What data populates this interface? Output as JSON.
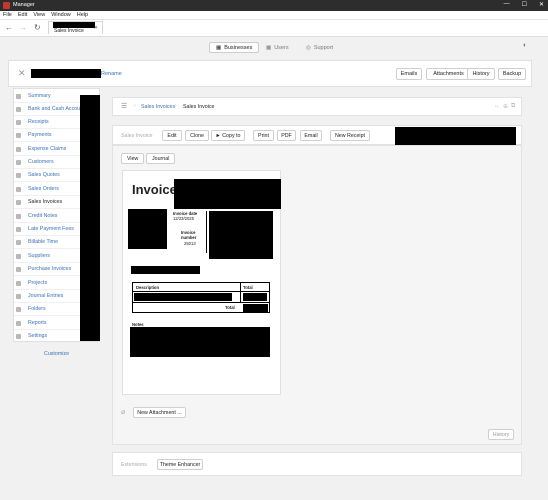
{
  "window": {
    "app_title": "Manager",
    "controls": [
      "—",
      "☐",
      "✕"
    ]
  },
  "menu": [
    "File",
    "Edit",
    "View",
    "Window",
    "Help"
  ],
  "tab": {
    "title": "Sales Invoice",
    "close": "✕"
  },
  "modes": [
    {
      "label": "Businesses",
      "icon": "businesses-icon",
      "active": true
    },
    {
      "label": "Users",
      "icon": "users-icon",
      "active": false
    },
    {
      "label": "Support",
      "icon": "support-icon",
      "active": false
    }
  ],
  "header": {
    "rename": "Rename",
    "buttons": [
      "Emails",
      "Attachments",
      "History",
      "Backup"
    ]
  },
  "sidebar": {
    "items": [
      {
        "label": "Summary"
      },
      {
        "label": "Bank and Cash Accounts"
      },
      {
        "label": "Receipts"
      },
      {
        "label": "Payments"
      },
      {
        "label": "Expense Claims"
      },
      {
        "label": "Customers"
      },
      {
        "label": "Sales Quotes"
      },
      {
        "label": "Sales Orders"
      },
      {
        "label": "Sales Invoices",
        "active": true
      },
      {
        "label": "Credit Notes"
      },
      {
        "label": "Late Payment Fees"
      },
      {
        "label": "Billable Time"
      },
      {
        "label": "Suppliers"
      },
      {
        "label": "Purchase Invoices"
      },
      {
        "label": "Projects"
      },
      {
        "label": "Journal Entries"
      },
      {
        "label": "Folders"
      },
      {
        "label": "Reports"
      },
      {
        "label": "Settings"
      }
    ],
    "customize": "Customize"
  },
  "breadcrumb": {
    "first": "Sales Invoices",
    "sep": "›",
    "second": "Sales Invoice"
  },
  "toolbar": {
    "label": "Sales Invoice",
    "edit": "Edit",
    "clone": "Clone",
    "copy_to": "► Copy to",
    "print": "Print",
    "pdf": "PDF",
    "email": "Email",
    "new_receipt": "New Receipt"
  },
  "view_tabs": {
    "view": "View",
    "journal": "Journal"
  },
  "invoice": {
    "title": "Invoice",
    "date_label": "Invoice date",
    "date_value": "12/23/2025",
    "number_label_1": "Invoice",
    "number_label_2": "number",
    "number_value": "25013",
    "col_description": "Description",
    "col_total": "Total",
    "total_label": "Total",
    "notes_label": "Notes"
  },
  "attachments": {
    "new_button": "New Attachment ..."
  },
  "history_button": "History",
  "extensions": {
    "label": "Extensions",
    "theme_enhancer": "Theme Enhancer"
  }
}
